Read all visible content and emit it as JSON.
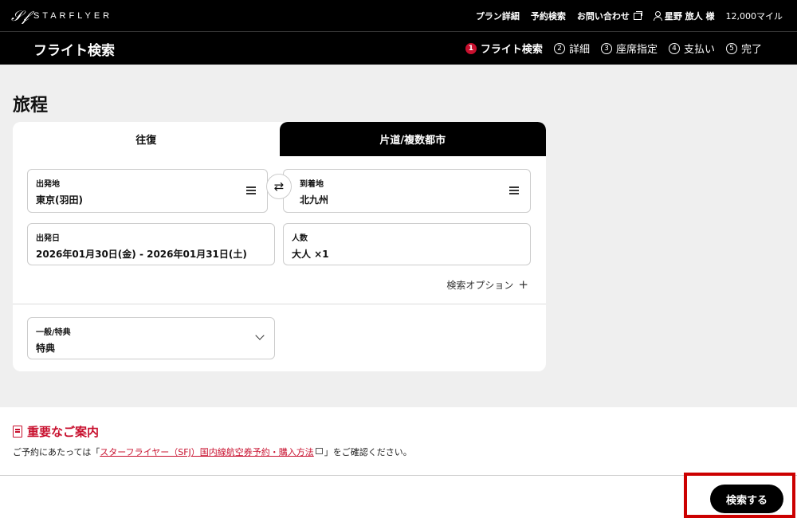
{
  "header": {
    "logo_text": "STARFLYER",
    "nav": {
      "plan_details": "プラン詳細",
      "booking_search": "予約検索",
      "contact": "お問い合わせ",
      "user_name": "星野 旅人 様",
      "miles": "12,000マイル"
    }
  },
  "subheader": {
    "title": "フライト検索",
    "steps": [
      {
        "num": "1",
        "label": "フライト検索"
      },
      {
        "num": "2",
        "label": "詳細"
      },
      {
        "num": "3",
        "label": "座席指定"
      },
      {
        "num": "4",
        "label": "支払い"
      },
      {
        "num": "5",
        "label": "完了"
      }
    ]
  },
  "itinerary": {
    "heading": "旅程",
    "tabs": {
      "round_trip": "往復",
      "one_way": "片道/複数都市"
    },
    "departure": {
      "label": "出発地",
      "value": "東京(羽田)"
    },
    "arrival": {
      "label": "到着地",
      "value": "北九州"
    },
    "swap_symbol": "⇄",
    "date": {
      "label": "出発日",
      "value": "2026年01月30日(金) - 2026年01月31日(土)"
    },
    "passengers": {
      "label": "人数",
      "value": "大人 ×1"
    },
    "search_options": "検索オプション",
    "fare_type": {
      "label": "一般/特典",
      "value": "特典"
    }
  },
  "notice": {
    "title": "重要なご案内",
    "text_before": "ご予約にあたっては「",
    "link_text": "スターフライヤー（SFJ）国内線航空券予約・購入方法",
    "text_after": "」をご確認ください。"
  },
  "footer": {
    "search_button": "検索する"
  },
  "colors": {
    "accent": "#c8102e",
    "header_bg": "#000000",
    "highlight_border": "#cc0000"
  }
}
